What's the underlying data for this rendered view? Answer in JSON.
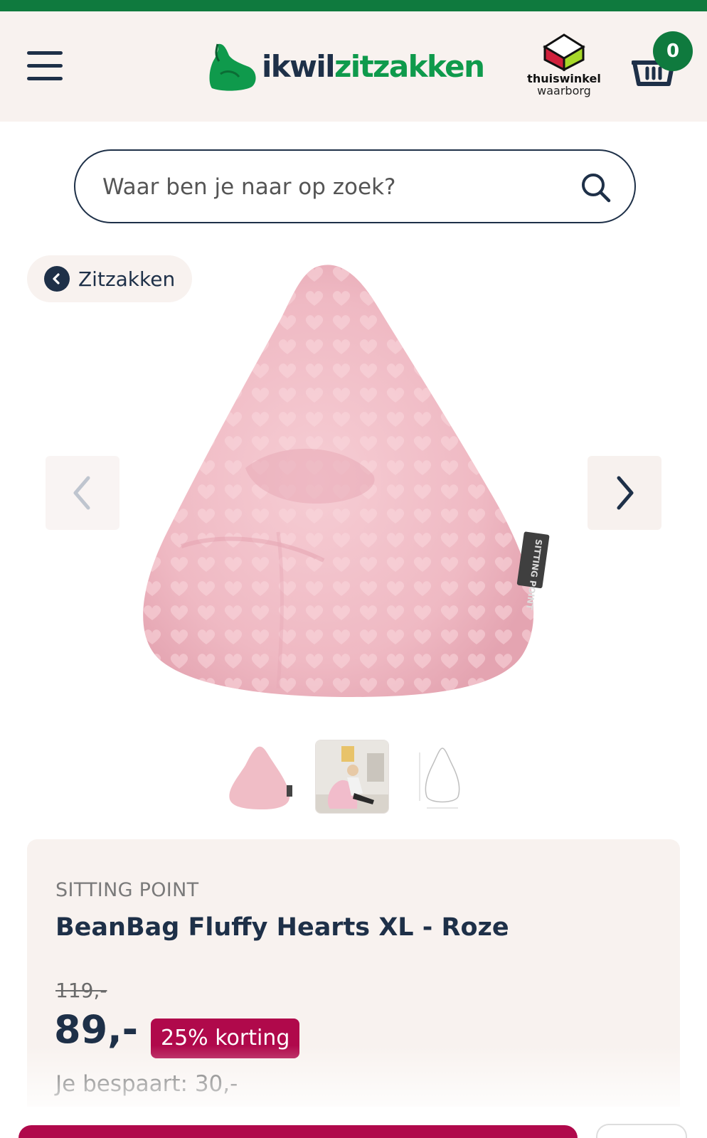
{
  "colors": {
    "brand_green": "#0f7a3e",
    "navy": "#1e3048",
    "header_bg": "#f8f2ef",
    "discount_red": "#b0094b"
  },
  "header": {
    "logo_part1": "ikwil",
    "logo_part2": "zitzakken",
    "trust_line1": "thuiswinkel",
    "trust_line2": "waarborg",
    "cart_count": "0"
  },
  "search": {
    "placeholder": "Waar ben je naar op zoek?"
  },
  "breadcrumb": {
    "label": "Zitzakken"
  },
  "product": {
    "brand": "SITTING POINT",
    "title": "BeanBag Fluffy Hearts XL - Roze",
    "old_price": "119,-",
    "price": "89,-",
    "discount_label": "25% korting",
    "savings": "Je bespaart: 30,-",
    "tag_text": "SITTING POINT",
    "thumbnails": [
      "thumbnail-1",
      "thumbnail-2",
      "thumbnail-3"
    ]
  },
  "icons": {
    "menu": "hamburger-menu-icon",
    "search": "search-icon",
    "cart": "basket-icon",
    "back": "chevron-left-circle-icon",
    "prev": "chevron-left-icon",
    "next": "chevron-right-icon"
  }
}
